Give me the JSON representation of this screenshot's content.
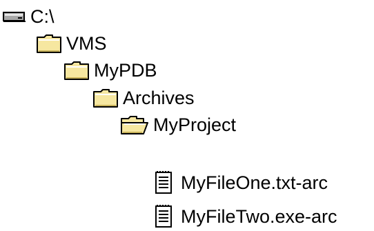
{
  "tree": {
    "drive": {
      "label": "C:\\",
      "icon": "drive-icon"
    },
    "folders": [
      {
        "label": "VMS",
        "icon": "folder-closed-icon"
      },
      {
        "label": "MyPDB",
        "icon": "folder-closed-icon"
      },
      {
        "label": "Archives",
        "icon": "folder-closed-icon"
      },
      {
        "label": "MyProject",
        "icon": "folder-open-icon"
      }
    ],
    "files": [
      {
        "label": "MyFileOne.txt-arc",
        "icon": "document-icon"
      },
      {
        "label": "MyFileTwo.exe-arc",
        "icon": "document-icon"
      }
    ]
  },
  "colors": {
    "folder_fill": "#F6E7A0",
    "folder_shadow": "#C9B35A",
    "folder_outline": "#000000",
    "drive_body": "#A8A8A8",
    "text": "#000000",
    "background": "#FFFFFF"
  }
}
